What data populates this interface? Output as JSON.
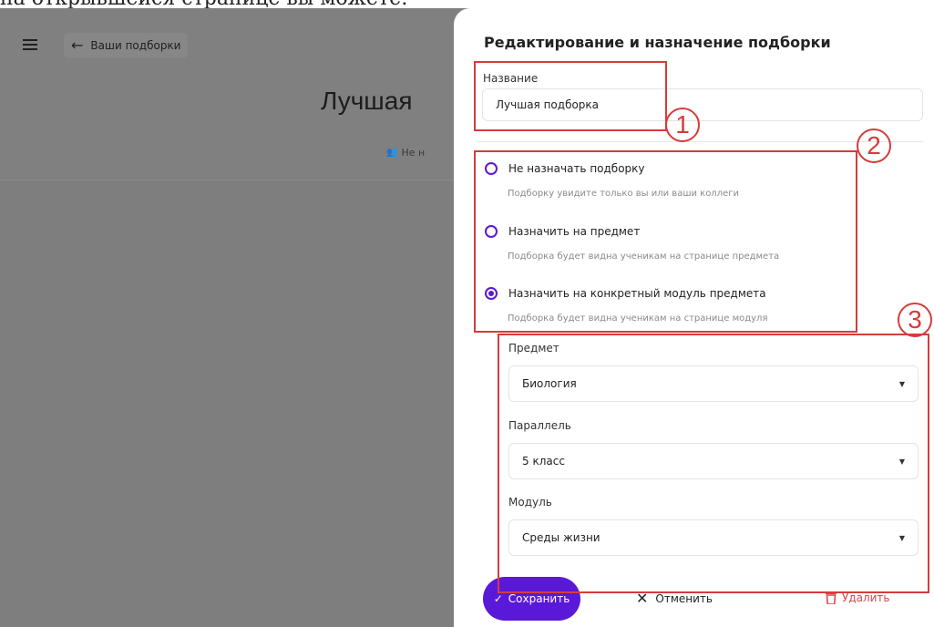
{
  "caption": "на открывшейся странице вы можете:",
  "background": {
    "back_label": "Ваши подборки",
    "title": "Лучшая",
    "subtitle": "Не н"
  },
  "panel": {
    "title": "Редактирование и назначение подборки",
    "name_label": "Название",
    "name_value": "Лучшая подборка",
    "options": [
      {
        "label": "Не назначать подборку",
        "hint": "Подборку увидите только вы или ваши коллеги",
        "selected": false
      },
      {
        "label": "Назначить на предмет",
        "hint": "Подборка будет видна ученикам на странице предмета",
        "selected": false
      },
      {
        "label": "Назначить на конкретный модуль предмета",
        "hint": "Подборка будет видна ученикам на странице модуля",
        "selected": true
      }
    ],
    "subject_label": "Предмет",
    "subject_value": "Биология",
    "grade_label": "Параллель",
    "grade_value": "5 класс",
    "module_label": "Модуль",
    "module_value": "Среды жизни",
    "save_label": "Сохранить",
    "cancel_label": "Отменить",
    "delete_label": "Удалить"
  },
  "annotations": [
    "1",
    "2",
    "3"
  ],
  "colors": {
    "accent": "#5a18d8",
    "annotation": "#d63b3b",
    "delete": "#d44848",
    "backdrop": "#7e7e7e"
  }
}
